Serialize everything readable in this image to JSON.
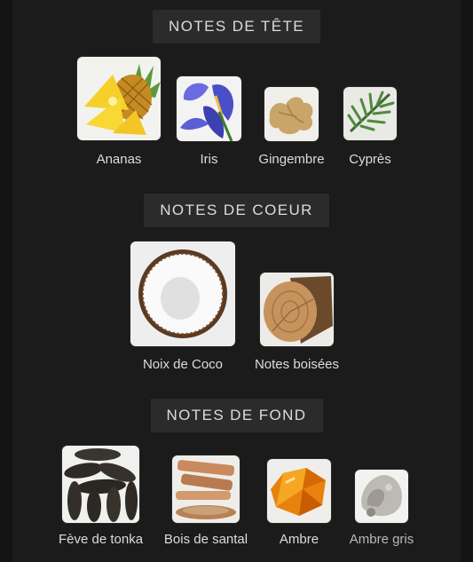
{
  "sections": {
    "top": {
      "title": "NOTES DE TÊTE",
      "items": [
        {
          "label": "Ananas",
          "icon": "pineapple-icon"
        },
        {
          "label": "Iris",
          "icon": "iris-flower-icon"
        },
        {
          "label": "Gingembre",
          "icon": "ginger-icon"
        },
        {
          "label": "Cyprès",
          "icon": "cypress-icon"
        }
      ]
    },
    "heart": {
      "title": "NOTES DE COEUR",
      "items": [
        {
          "label": "Noix de Coco",
          "icon": "coconut-icon"
        },
        {
          "label": "Notes boisées",
          "icon": "wood-log-icon"
        }
      ]
    },
    "base": {
      "title": "NOTES DE FOND",
      "items": [
        {
          "label": "Fève de tonka",
          "icon": "tonka-bean-icon"
        },
        {
          "label": "Bois de santal",
          "icon": "sandalwood-icon"
        },
        {
          "label": "Ambre",
          "icon": "amber-icon"
        },
        {
          "label": "Ambre gris",
          "icon": "ambergris-icon"
        }
      ]
    }
  },
  "colors": {
    "background": "#1b1b1b",
    "title_background": "#2b2b2b",
    "text": "#dcdcdc"
  }
}
